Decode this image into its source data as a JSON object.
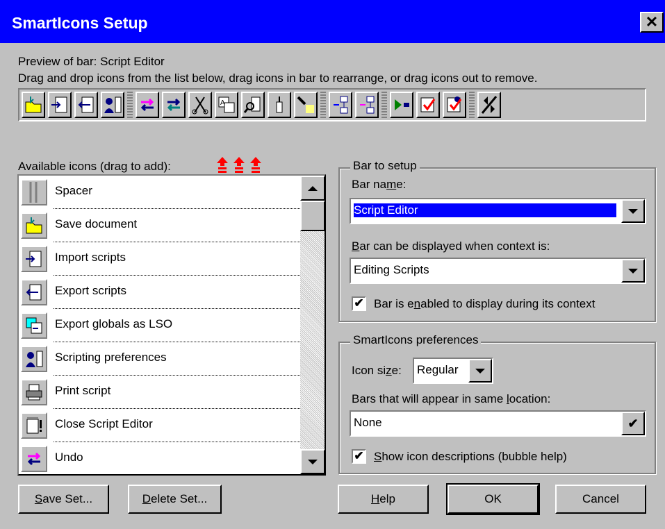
{
  "window": {
    "title": "SmartIcons Setup",
    "close_label": "✕"
  },
  "preview": {
    "label": "Preview of bar:  Script Editor",
    "instructions": "Drag and drop icons from the list below, drag icons in bar to rearrange, or drag icons out to remove.",
    "icons": [
      "save-document-icon",
      "import-scripts-icon",
      "export-scripts-icon",
      "scripting-preferences-icon",
      "separator",
      "undo-icon",
      "redo-icon",
      "cut-icon",
      "paste-icon",
      "find-icon",
      "insert-icon",
      "browse-icon",
      "separator",
      "add-item-icon",
      "remove-item-icon",
      "separator",
      "run-icon",
      "check-icon",
      "check-all-icon",
      "separator",
      "next-bar-icon"
    ]
  },
  "available": {
    "label": "Available icons (drag to add):",
    "items": [
      {
        "label": "Spacer",
        "icon": "spacer-icon"
      },
      {
        "label": "Save document",
        "icon": "save-document-icon"
      },
      {
        "label": "Import scripts",
        "icon": "import-scripts-icon"
      },
      {
        "label": "Export scripts",
        "icon": "export-scripts-icon"
      },
      {
        "label": "Export globals as LSO",
        "icon": "export-globals-icon"
      },
      {
        "label": "Scripting preferences",
        "icon": "scripting-preferences-icon"
      },
      {
        "label": "Print script",
        "icon": "print-icon"
      },
      {
        "label": "Close Script Editor",
        "icon": "close-editor-icon"
      },
      {
        "label": "Undo",
        "icon": "undo-icon"
      }
    ]
  },
  "bar_setup": {
    "group_title": "Bar to setup",
    "name_label_pre": "Bar na",
    "name_label_u": "m",
    "name_label_post": "e:",
    "name_value": "Script Editor",
    "context_label_u": "B",
    "context_label_post": "ar can be displayed when context is:",
    "context_value": "Editing Scripts",
    "enabled_pre": "Bar is e",
    "enabled_u": "n",
    "enabled_post": "abled to display during its context",
    "enabled_checked": "✔"
  },
  "preferences": {
    "group_title": "SmartIcons preferences",
    "icon_size_pre": "Icon si",
    "icon_size_u": "z",
    "icon_size_post": "e:",
    "icon_size_value": "Regular",
    "bars_pre": "Bars that will appear in same ",
    "bars_u": "l",
    "bars_post": "ocation:",
    "bars_value": "None",
    "bars_check": "✔",
    "bubble_u": "S",
    "bubble_post": "how icon descriptions (bubble help)",
    "bubble_checked": "✔"
  },
  "buttons": {
    "save_set_u": "S",
    "save_set_post": "ave Set...",
    "delete_set_u": "D",
    "delete_set_post": "elete Set...",
    "help_u": "H",
    "help_post": "elp",
    "ok": "OK",
    "cancel": "Cancel"
  },
  "colors": {
    "titlebar": "#0000ff",
    "face": "#c0c0c0",
    "arrow_red": "#ff0000"
  }
}
